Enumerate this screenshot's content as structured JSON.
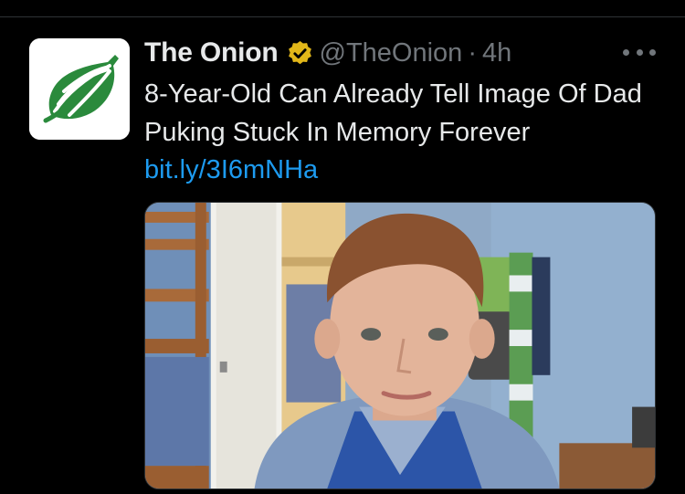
{
  "tweet": {
    "display_name": "The Onion",
    "handle": "@TheOnion",
    "separator": "·",
    "timestamp": "4h",
    "text": "8-Year-Old Can Already Tell Image Of Dad Puking Stuck In Memory Forever",
    "link": "bit.ly/3I6mNHa",
    "verified": true,
    "verified_badge_color": "#e2b719",
    "avatar_icon": "onion-logo-icon",
    "avatar_color": "#2a8a3c",
    "more_icon": "more-dots-icon",
    "link_color": "#1d9bf0"
  }
}
